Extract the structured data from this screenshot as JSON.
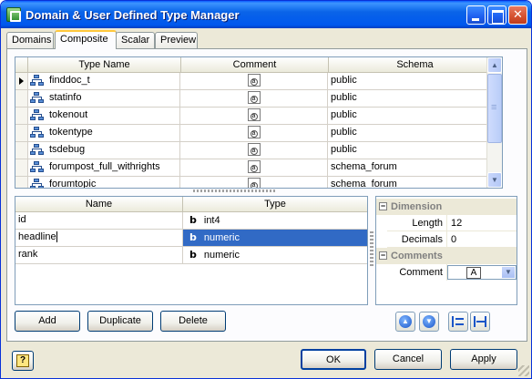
{
  "window": {
    "title": "Domain & User Defined Type Manager"
  },
  "tabs": [
    "Domains",
    "Composite",
    "Scalar",
    "Preview"
  ],
  "types_grid": {
    "columns": [
      "Type Name",
      "Comment",
      "Schema"
    ],
    "rows": [
      {
        "name": "finddoc_t",
        "comment_icon": "a",
        "schema": "public"
      },
      {
        "name": "statinfo",
        "comment_icon": "a",
        "schema": "public"
      },
      {
        "name": "tokenout",
        "comment_icon": "a",
        "schema": "public"
      },
      {
        "name": "tokentype",
        "comment_icon": "a",
        "schema": "public"
      },
      {
        "name": "tsdebug",
        "comment_icon": "a",
        "schema": "public"
      },
      {
        "name": "forumpost_full_withrights",
        "comment_icon": "a",
        "schema": "schema_forum"
      },
      {
        "name": "forumtopic",
        "comment_icon": "a",
        "schema": "schema_forum"
      }
    ]
  },
  "fields_grid": {
    "columns": [
      "Name",
      "Type"
    ],
    "rows": [
      {
        "name": "id",
        "type_icon": "b",
        "type": "int4"
      },
      {
        "name": "headline",
        "type_icon": "b",
        "type": "numeric"
      },
      {
        "name": "rank",
        "type_icon": "b",
        "type": "numeric"
      }
    ]
  },
  "properties": {
    "dimension_label": "Dimension",
    "length_label": "Length",
    "length_value": "12",
    "decimals_label": "Decimals",
    "decimals_value": "0",
    "comments_label": "Comments",
    "comment_label": "Comment",
    "comment_value": "A"
  },
  "buttons": {
    "add": "Add",
    "duplicate": "Duplicate",
    "delete": "Delete",
    "ok": "OK",
    "cancel": "Cancel",
    "apply": "Apply",
    "help": "?"
  },
  "icons": {
    "app": "app-icon",
    "move_up": "arrow-up-circle-icon",
    "move_down": "arrow-down-circle-icon",
    "align_left": "align-left-icon",
    "align_right": "align-right-icon"
  },
  "colors": {
    "selection": "#316ac5",
    "titlebar": "#0058ee",
    "face": "#ece9d8"
  }
}
